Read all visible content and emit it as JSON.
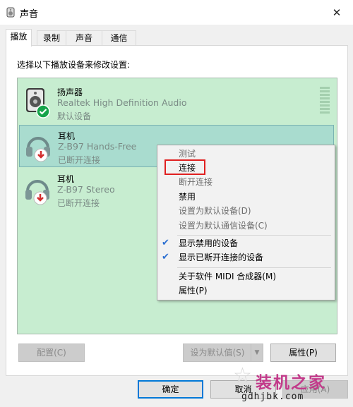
{
  "window": {
    "title": "声音",
    "close_glyph": "✕"
  },
  "tabs": [
    {
      "label": "播放",
      "active": true
    },
    {
      "label": "录制",
      "active": false
    },
    {
      "label": "声音",
      "active": false
    },
    {
      "label": "通信",
      "active": false
    }
  ],
  "instruction": "选择以下播放设备来修改设置:",
  "devices": [
    {
      "name": "扬声器",
      "description": "Realtek High Definition Audio",
      "status": "默认设备",
      "icon": "speaker-icon",
      "badge": "green-check"
    },
    {
      "name": "耳机",
      "description": "Z-B97 Hands-Free",
      "status": "已断开连接",
      "icon": "headphone-icon",
      "badge": "red-down-arrow",
      "selected": true
    },
    {
      "name": "耳机",
      "description": "Z-B97 Stereo",
      "status": "已断开连接",
      "icon": "headphone-icon",
      "badge": "red-down-arrow"
    }
  ],
  "context_menu": {
    "items": [
      {
        "label": "测试",
        "enabled": false
      },
      {
        "label": "连接",
        "enabled": true,
        "highlighted": true
      },
      {
        "label": "断开连接",
        "enabled": false
      },
      {
        "label": "禁用",
        "enabled": true
      },
      {
        "label": "设置为默认设备(D)",
        "enabled": false
      },
      {
        "label": "设置为默认通信设备(C)",
        "enabled": false
      },
      {
        "label": "显示禁用的设备",
        "enabled": true,
        "checked": true
      },
      {
        "label": "显示已断开连接的设备",
        "enabled": true,
        "checked": true
      },
      {
        "label": "关于软件 MIDI 合成器(M)",
        "enabled": true
      },
      {
        "label": "属性(P)",
        "enabled": true
      }
    ]
  },
  "buttons": {
    "configure": "配置(C)",
    "set_default": "设为默认值(S)",
    "properties": "属性(P)",
    "ok": "确定",
    "cancel": "取消",
    "apply": "应用(A)"
  },
  "watermark": {
    "main": "装机之家",
    "sub": "gdhjbk.com"
  },
  "colors": {
    "list_bg": "#c7edd0",
    "selected_bg": "#a9dccf",
    "highlight_border": "#e02020",
    "check": "#2a6ed1",
    "watermark": "#c23a8a"
  }
}
